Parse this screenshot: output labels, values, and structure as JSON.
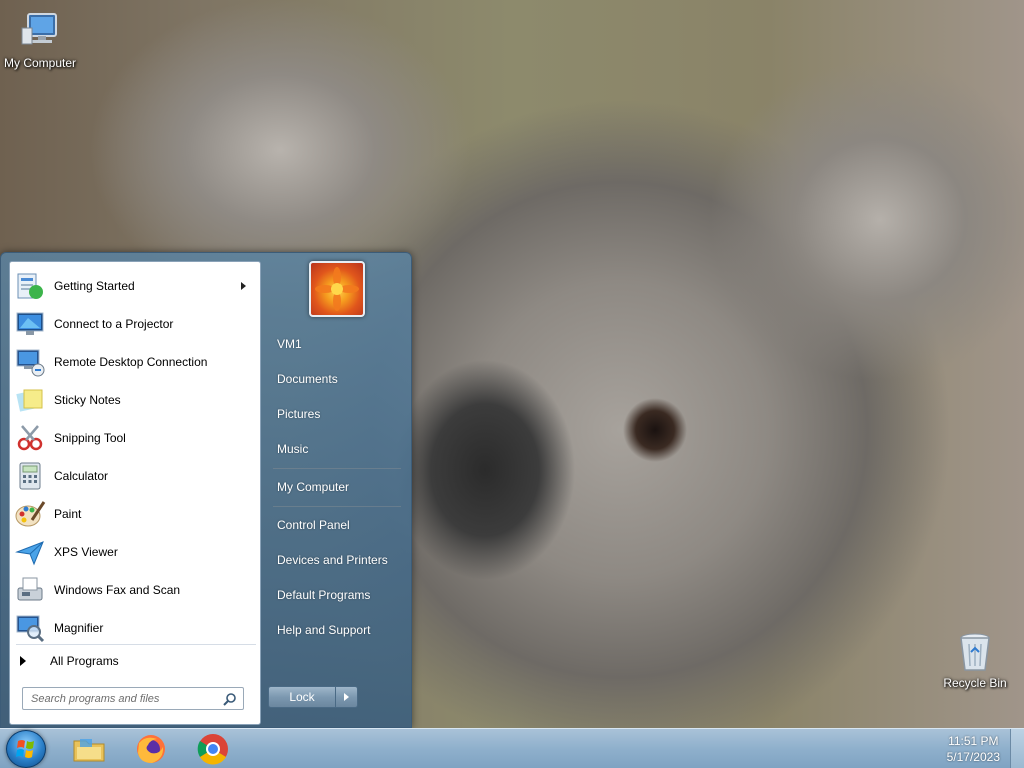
{
  "desktop": {
    "icons": [
      {
        "label": "My Computer",
        "icon": "my-computer-icon"
      },
      {
        "label": "Recycle Bin",
        "icon": "recycle-bin-icon"
      }
    ]
  },
  "start_menu": {
    "programs": [
      {
        "label": "Getting Started",
        "icon": "getting-started-icon",
        "has_submenu": true
      },
      {
        "label": "Connect to a Projector",
        "icon": "projector-icon"
      },
      {
        "label": "Remote Desktop Connection",
        "icon": "remote-desktop-icon"
      },
      {
        "label": "Sticky Notes",
        "icon": "sticky-notes-icon"
      },
      {
        "label": "Snipping Tool",
        "icon": "snipping-tool-icon"
      },
      {
        "label": "Calculator",
        "icon": "calculator-icon"
      },
      {
        "label": "Paint",
        "icon": "paint-icon"
      },
      {
        "label": "XPS Viewer",
        "icon": "xps-viewer-icon"
      },
      {
        "label": "Windows Fax and Scan",
        "icon": "fax-scan-icon"
      },
      {
        "label": "Magnifier",
        "icon": "magnifier-icon"
      }
    ],
    "all_programs_label": "All Programs",
    "search_placeholder": "Search programs and files",
    "right_items": [
      {
        "label": "VM1"
      },
      {
        "label": "Documents"
      },
      {
        "label": "Pictures"
      },
      {
        "label": "Music"
      },
      {
        "label": "My Computer"
      },
      {
        "label": "Control Panel"
      },
      {
        "label": "Devices and Printers"
      },
      {
        "label": "Default Programs"
      },
      {
        "label": "Help and Support"
      }
    ],
    "lock_label": "Lock"
  },
  "taskbar": {
    "pinned": [
      {
        "icon": "file-explorer-icon"
      },
      {
        "icon": "firefox-icon"
      },
      {
        "icon": "chrome-icon"
      }
    ],
    "clock": {
      "time": "11:51 PM",
      "date": "5/17/2023"
    }
  },
  "colors": {
    "accent": "#2a7fc8",
    "taskbar": "#8fb0cc",
    "start_menu": "#4f7a9e"
  }
}
